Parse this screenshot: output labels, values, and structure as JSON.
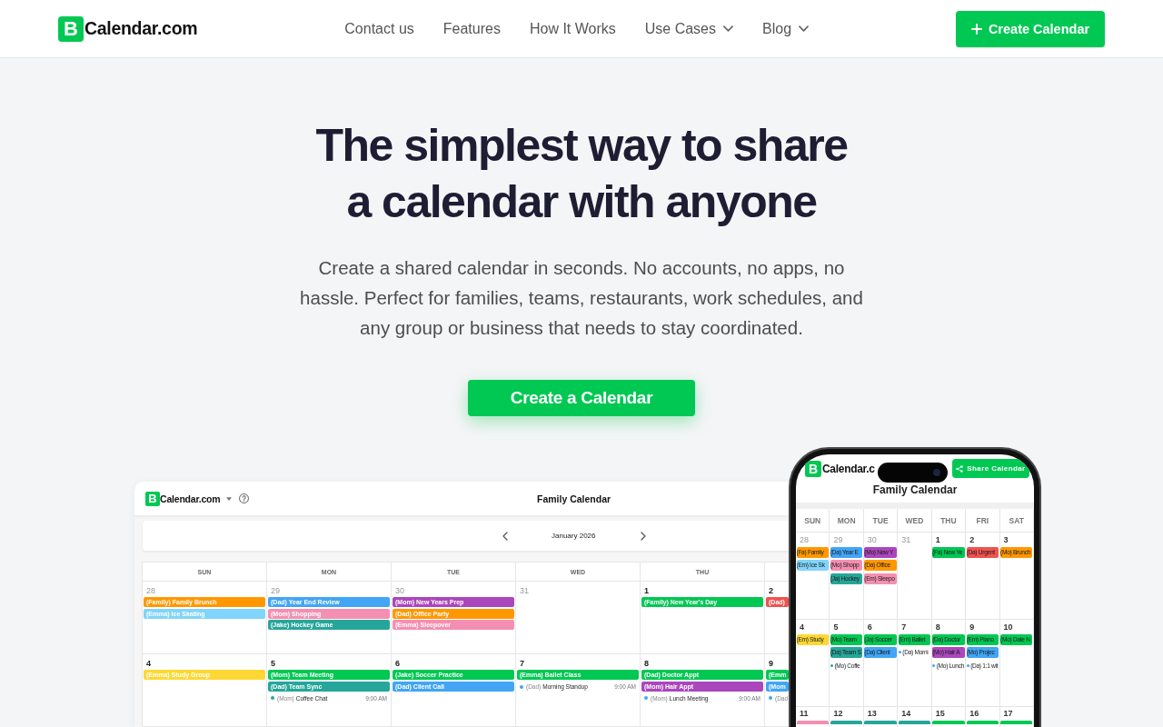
{
  "header": {
    "logo": {
      "mark": "B",
      "text": "Calendar.com"
    },
    "nav": [
      {
        "label": "Contact us",
        "dropdown": false
      },
      {
        "label": "Features",
        "dropdown": false
      },
      {
        "label": "How It Works",
        "dropdown": false
      },
      {
        "label": "Use Cases",
        "dropdown": true
      },
      {
        "label": "Blog",
        "dropdown": true
      }
    ],
    "cta": {
      "label": "Create Calendar"
    }
  },
  "hero": {
    "title": "The simplest way to share a calendar with anyone",
    "subtitle": "Create a shared calendar in seconds. No accounts, no apps, no hassle. Perfect for families, teams, restaurants, work schedules, and any group or business that needs to stay coordinated.",
    "button": "Create a Calendar"
  },
  "desktop_preview": {
    "logo": {
      "mark": "B",
      "text": "Calendar.com"
    },
    "title": "Family Calendar",
    "month": "January 2026",
    "weekdays": [
      "SUN",
      "MON",
      "TUE",
      "WED",
      "THU"
    ],
    "weeks": [
      {
        "days": [
          {
            "date": "28",
            "outside_month": true,
            "events": [
              {
                "kind": "bar",
                "text": "(Family) Family Brunch",
                "color": "#ff9800"
              },
              {
                "kind": "bar",
                "text": "(Emma) Ice Skating",
                "color": "#81d4fa"
              }
            ]
          },
          {
            "date": "29",
            "outside_month": true,
            "events": [
              {
                "kind": "bar",
                "text": "(Dad) Year End Review",
                "color": "#42a5f5"
              },
              {
                "kind": "bar",
                "text": "(Mom) Shopping",
                "color": "#f48fb1"
              },
              {
                "kind": "bar",
                "text": "(Jake) Hockey Game",
                "color": "#26a69a"
              }
            ]
          },
          {
            "date": "30",
            "outside_month": true,
            "events": [
              {
                "kind": "bar",
                "text": "(Mom) New Years Prep",
                "color": "#ab47bc"
              },
              {
                "kind": "bar",
                "text": "(Dad) Office Party",
                "color": "#ff9800"
              },
              {
                "kind": "bar",
                "text": "(Emma) Sleepover",
                "color": "#f48fb1"
              }
            ]
          },
          {
            "date": "31",
            "outside_month": true
          },
          {
            "date": "1",
            "outside_month": false,
            "events": [
              {
                "kind": "bar",
                "text": "(Family) New Year's Day",
                "color": "#00c853"
              }
            ]
          },
          {
            "date": "2",
            "outside_month": false,
            "events": [
              {
                "kind": "bar",
                "text": "(Dad)",
                "color": "#ef5350"
              }
            ]
          }
        ]
      },
      {
        "days": [
          {
            "date": "4",
            "outside_month": false,
            "events": [
              {
                "kind": "bar",
                "text": "(Emma) Study Group",
                "color": "#fdd835"
              }
            ]
          },
          {
            "date": "5",
            "outside_month": false,
            "events": [
              {
                "kind": "bar",
                "text": "(Mom) Team Meeting",
                "color": "#00c853"
              },
              {
                "kind": "bar",
                "text": "(Dad) Team Sync",
                "color": "#26a69a"
              },
              {
                "kind": "dot",
                "owner": "(Mom)",
                "title": "Coffee Chat",
                "time": "9:00 AM",
                "color": "#26a69a"
              }
            ]
          },
          {
            "date": "6",
            "outside_month": false,
            "events": [
              {
                "kind": "bar",
                "text": "(Jake) Soccer Practice",
                "color": "#00c853"
              },
              {
                "kind": "bar",
                "text": "(Dad) Client Call",
                "color": "#42a5f5"
              }
            ]
          },
          {
            "date": "7",
            "outside_month": false,
            "events": [
              {
                "kind": "bar",
                "text": "(Emma) Ballet Class",
                "color": "#00c853"
              },
              {
                "kind": "dot",
                "owner": "(Dad)",
                "title": "Morning Standup",
                "time": "9:00 AM",
                "color": "#42a5f5"
              }
            ]
          },
          {
            "date": "8",
            "outside_month": false,
            "events": [
              {
                "kind": "bar",
                "text": "(Dad) Doctor Appt",
                "color": "#00c853"
              },
              {
                "kind": "bar",
                "text": "(Mom) Hair Appt",
                "color": "#ab47bc"
              },
              {
                "kind": "dot",
                "owner": "(Mom)",
                "title": "Lunch Meeting",
                "time": "9:00 AM",
                "color": "#42a5f5"
              }
            ]
          },
          {
            "date": "9",
            "outside_month": false,
            "events": [
              {
                "kind": "bar",
                "text": "(Emm",
                "color": "#00c853"
              },
              {
                "kind": "bar",
                "text": "(Mom",
                "color": "#42a5f5"
              },
              {
                "kind": "dot",
                "owner": "(Dad",
                "color": "#42a5f5"
              }
            ]
          }
        ]
      }
    ]
  },
  "phone_preview": {
    "logo": {
      "mark": "B",
      "text": "Calendar.c"
    },
    "share_button": "Share Calendar",
    "title": "Family Calendar",
    "weekdays": [
      "SUN",
      "MON",
      "TUE",
      "WED",
      "THU",
      "FRI",
      "SAT"
    ],
    "weeks": [
      {
        "days": [
          {
            "date": "28",
            "outside_month": true,
            "events": [
              {
                "kind": "bar",
                "text": "(Fa) Family",
                "color": "#ff9800"
              },
              {
                "kind": "bar",
                "text": "(Em) Ice Sk",
                "color": "#81d4fa"
              }
            ]
          },
          {
            "date": "29",
            "outside_month": true,
            "events": [
              {
                "kind": "bar",
                "text": "(Da) Year E",
                "color": "#42a5f5"
              },
              {
                "kind": "bar",
                "text": "(Mo) Shopp",
                "color": "#f48fb1"
              },
              {
                "kind": "bar",
                "text": "(Ja) Hockey",
                "color": "#26a69a"
              }
            ]
          },
          {
            "date": "30",
            "outside_month": true,
            "events": [
              {
                "kind": "bar",
                "text": "(Mo) New Y",
                "color": "#ab47bc"
              },
              {
                "kind": "bar",
                "text": "(Da) Office",
                "color": "#ff9800"
              },
              {
                "kind": "bar",
                "text": "(Em) Sleepo",
                "color": "#f48fb1"
              }
            ]
          },
          {
            "date": "31",
            "outside_month": true
          },
          {
            "date": "1",
            "outside_month": false,
            "events": [
              {
                "kind": "bar",
                "text": "(Fa) New Ye",
                "color": "#00c853"
              }
            ]
          },
          {
            "date": "2",
            "outside_month": false,
            "events": [
              {
                "kind": "bar",
                "text": "(Da) Urgent",
                "color": "#ef5350"
              }
            ]
          },
          {
            "date": "3",
            "outside_month": false,
            "events": [
              {
                "kind": "bar",
                "text": "(Mo) Brunch",
                "color": "#ff9800"
              }
            ]
          }
        ]
      },
      {
        "days": [
          {
            "date": "4",
            "outside_month": false,
            "events": [
              {
                "kind": "bar",
                "text": "(Em) Study",
                "color": "#fdd835"
              }
            ]
          },
          {
            "date": "5",
            "outside_month": false,
            "events": [
              {
                "kind": "bar",
                "text": "(Mo) Team",
                "color": "#00c853"
              },
              {
                "kind": "bar",
                "text": "(Da) Team S",
                "color": "#26a69a"
              },
              {
                "kind": "dot",
                "text": "(Mo) Coffe",
                "color": "#26a69a"
              }
            ]
          },
          {
            "date": "6",
            "outside_month": false,
            "events": [
              {
                "kind": "bar",
                "text": "(Ja) Soccer",
                "color": "#00c853"
              },
              {
                "kind": "bar",
                "text": "(Da) Client",
                "color": "#42a5f5"
              }
            ]
          },
          {
            "date": "7",
            "outside_month": false,
            "events": [
              {
                "kind": "bar",
                "text": "(Em) Ballet",
                "color": "#00c853"
              },
              {
                "kind": "dot",
                "text": "(Da) Morni",
                "color": "#42a5f5"
              }
            ]
          },
          {
            "date": "8",
            "outside_month": false,
            "events": [
              {
                "kind": "bar",
                "text": "(Da) Doctor",
                "color": "#00c853"
              },
              {
                "kind": "bar",
                "text": "(Mo) Hair A",
                "color": "#ab47bc"
              },
              {
                "kind": "dot",
                "text": "(Mo) Lunch",
                "color": "#42a5f5"
              }
            ]
          },
          {
            "date": "9",
            "outside_month": false,
            "events": [
              {
                "kind": "bar",
                "text": "(Em) Piano",
                "color": "#00c853"
              },
              {
                "kind": "bar",
                "text": "(Mo) Projec",
                "color": "#42a5f5"
              },
              {
                "kind": "dot",
                "text": "(Da) 1:1 wit",
                "color": "#42a5f5"
              }
            ]
          },
          {
            "date": "10",
            "outside_month": false,
            "events": [
              {
                "kind": "bar",
                "text": "(Mo) Date N",
                "color": "#00c853"
              }
            ]
          }
        ]
      },
      {
        "days": [
          {
            "date": "11",
            "outside_month": false,
            "events": [
              {
                "kind": "bar",
                "color": "#f48fb1"
              }
            ]
          },
          {
            "date": "12",
            "outside_month": false,
            "events": [
              {
                "kind": "bar",
                "color": "#26a69a"
              }
            ]
          },
          {
            "date": "13",
            "outside_month": false,
            "events": [
              {
                "kind": "bar",
                "color": "#26a69a"
              }
            ]
          },
          {
            "date": "14",
            "outside_month": false,
            "events": [
              {
                "kind": "bar",
                "color": "#26a69a"
              }
            ]
          },
          {
            "date": "15",
            "outside_month": false,
            "events": [
              {
                "kind": "bar",
                "color": "#00c853"
              }
            ]
          },
          {
            "date": "16",
            "outside_month": false,
            "events": [
              {
                "kind": "bar",
                "color": "#00c853"
              }
            ]
          },
          {
            "date": "17",
            "outside_month": false,
            "events": [
              {
                "kind": "bar",
                "color": "#00c853"
              }
            ]
          }
        ]
      }
    ]
  }
}
